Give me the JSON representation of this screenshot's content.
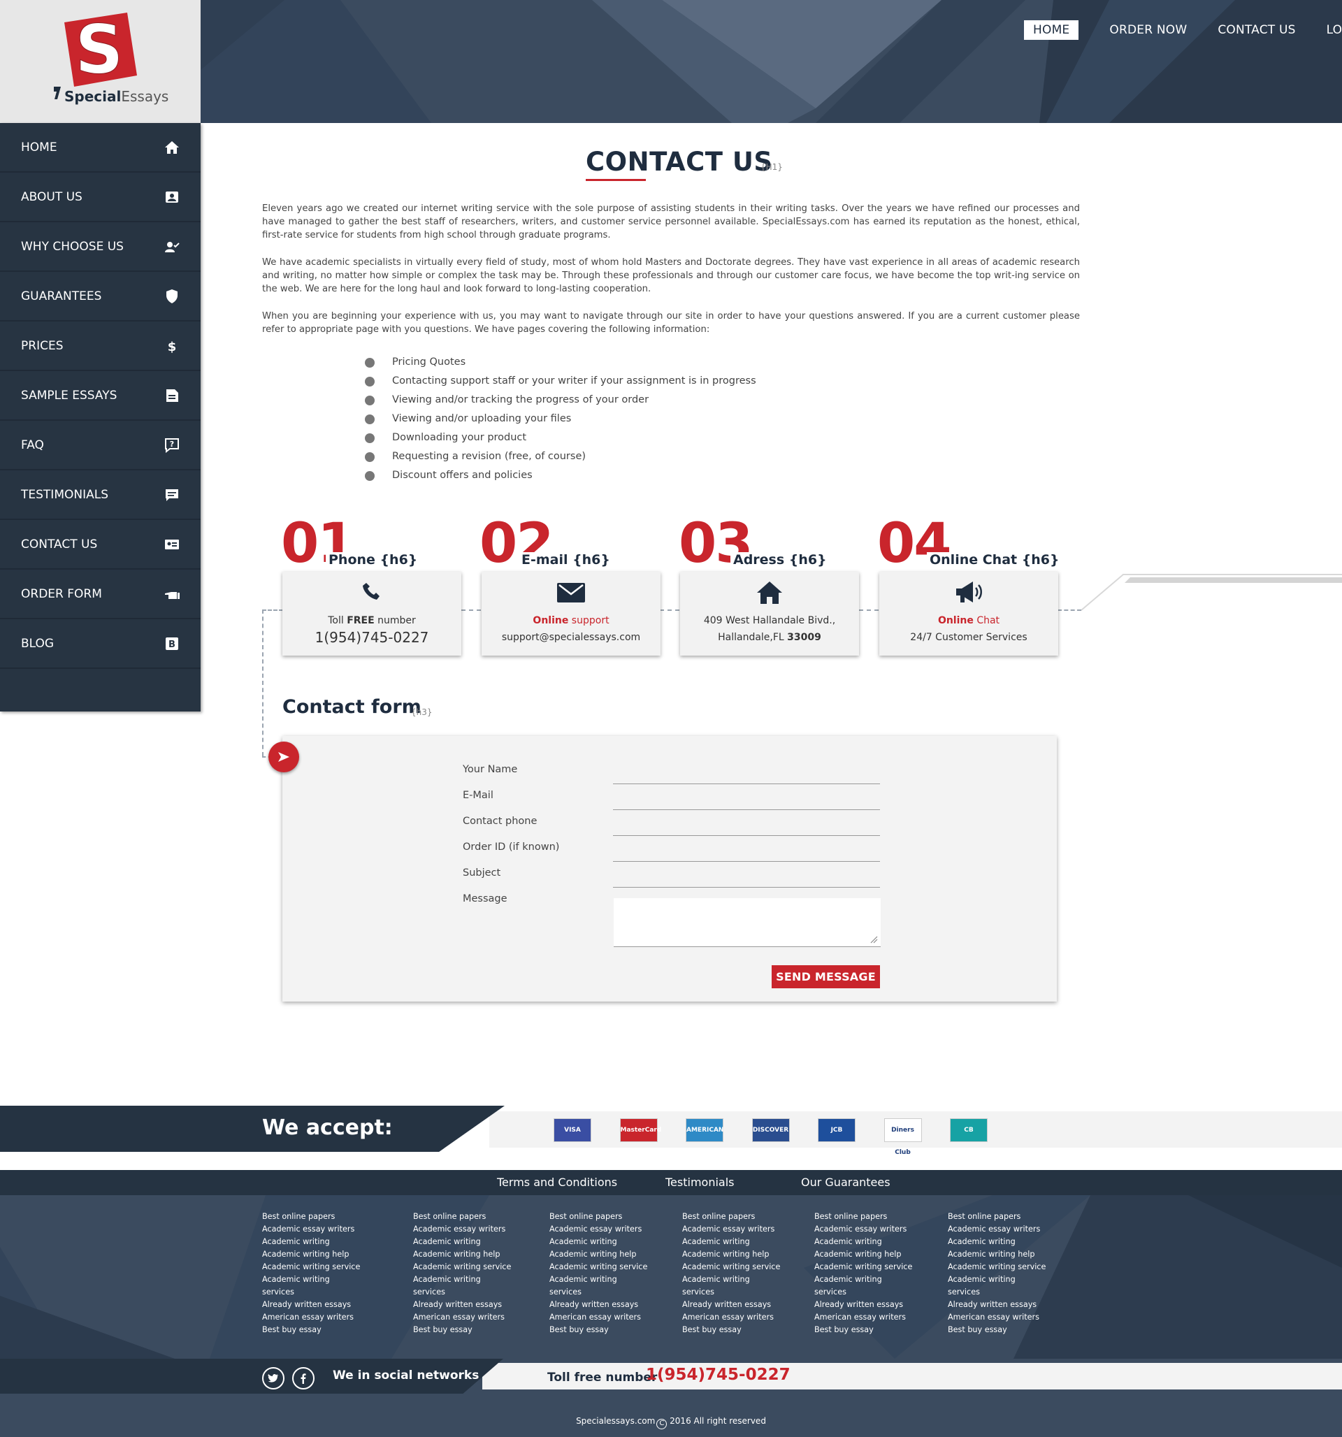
{
  "brand": {
    "special": "Special",
    "essays": "Essays"
  },
  "topnav": [
    {
      "label": "HOME",
      "active": true
    },
    {
      "label": "ORDER NOW"
    },
    {
      "label": "CONTACT US"
    },
    {
      "label": "LOGIN"
    }
  ],
  "sidebar": [
    {
      "label": "HOME",
      "icon": "home-icon"
    },
    {
      "label": "ABOUT US",
      "icon": "id-card-icon"
    },
    {
      "label": "WHY CHOOSE US",
      "icon": "user-check-icon"
    },
    {
      "label": "GUARANTEES",
      "icon": "shield-icon"
    },
    {
      "label": "PRICES",
      "icon": "dollar-icon"
    },
    {
      "label": "SAMPLE ESSAYS",
      "icon": "document-icon"
    },
    {
      "label": "FAQ",
      "icon": "question-bubble-icon"
    },
    {
      "label": "TESTIMONIALS",
      "icon": "comment-icon"
    },
    {
      "label": "CONTACT US",
      "icon": "contact-card-icon"
    },
    {
      "label": "ORDER FORM",
      "icon": "hand-point-icon"
    },
    {
      "label": "BLOG",
      "icon": "blog-icon"
    }
  ],
  "main": {
    "title": "CONTACT US",
    "title_tag": "{H1}",
    "paragraphs": [
      "Eleven years ago we created our internet writing service with the sole purpose of assisting students in their writing tasks. Over the years we have refined our processes and have managed to gather the best staff of researchers, writers, and customer service personnel available.  SpecialEssays.com has earned its reputation as the honest, ethical, first-rate service for students from high school through graduate programs.",
      "We have academic specialists in virtually every field of study, most of whom hold Masters and Doctorate degrees.  They have vast experience in all areas of academic research and writing, no matter how simple or complex the task may be. Through these professionals and through our customer care focus, we have become the top writ-ing service on the web.  We are here for the long haul and look forward to long-lasting cooperation.",
      "When you are beginning your experience with us, you may want to navigate through our site in order to have your questions answered.  If you are a current customer please refer to appropriate page with you questions.  We have pages covering the following information:"
    ],
    "bullets": [
      "Pricing Quotes",
      "Contacting support staff or your writer if your assignment is in progress",
      "Viewing and/or tracking the progress of your order",
      "Viewing and/or uploading your files",
      "Downloading your product",
      "Requesting a revision (free, of course)",
      "Discount offers and policies"
    ]
  },
  "steps": [
    {
      "num": "01",
      "title": "Phone {h6}",
      "icon": "phone-icon",
      "l1a": "Toll ",
      "l1b": "FREE",
      "l1c": " number",
      "l2": "1(954)745-0227"
    },
    {
      "num": "02",
      "title": "E-mail {h6}",
      "icon": "envelope-icon",
      "l1a": "",
      "l1b": "Online",
      "l1c": " support",
      "l2": "support@specialessays.com"
    },
    {
      "num": "03",
      "title": "Adress {h6}",
      "icon": "house-icon",
      "l1a": "409 West Hallandale Bivd.,",
      "l1b": "",
      "l1c": "",
      "l2a": "Hallandale,FL ",
      "l2b": "33009"
    },
    {
      "num": "04",
      "title": "Online Chat {h6}",
      "icon": "megaphone-icon",
      "l1a": "",
      "l1b": "Online",
      "l1c": " Chat",
      "l2": "24/7 Customer Services"
    }
  ],
  "form": {
    "title": "Contact form",
    "title_tag": "{h3}",
    "fields": [
      "Your Name",
      "E-Mail",
      "Contact phone",
      "Order ID (if known)",
      "Subject",
      "Message"
    ],
    "submit": "SEND MESSAGE"
  },
  "accept": {
    "title": "We accept:",
    "cards": [
      {
        "name": "VISA",
        "color": "#3a4ea3"
      },
      {
        "name": "MasterCard",
        "color": "#c9252c"
      },
      {
        "name": "AMERICAN EXPRESS",
        "color": "#2e8ac6"
      },
      {
        "name": "DISCOVER",
        "color": "#2a4d8f"
      },
      {
        "name": "JCB",
        "color": "#1e4f9c"
      },
      {
        "name": "Diners Club",
        "color": "#ffffff"
      },
      {
        "name": "CB",
        "color": "#17a2a4"
      }
    ]
  },
  "footer": {
    "nav": [
      "Terms and Conditions",
      "Testimonials",
      "Our Guarantees"
    ],
    "columns": [
      [
        "Best online papers",
        "Academic essay writers",
        "Academic writing",
        "Academic writing help",
        "Academic writing service",
        "Academic writing",
        "services",
        "Already written essays",
        "American essay writers",
        "Best buy essay"
      ],
      [
        "Best online papers",
        "Academic essay writers",
        "Academic writing",
        "Academic writing help",
        "Academic writing service",
        "Academic writing",
        "services",
        "Already written essays",
        "American essay writers",
        "Best buy essay"
      ],
      [
        "Best online papers",
        "Academic essay writers",
        "Academic writing",
        "Academic writing help",
        "Academic writing service",
        "Academic writing",
        "services",
        "Already written essays",
        "American essay writers",
        "Best buy essay"
      ],
      [
        "Best online papers",
        "Academic essay writers",
        "Academic writing",
        "Academic writing help",
        "Academic writing service",
        "Academic writing",
        "services",
        "Already written essays",
        "American essay writers",
        "Best buy essay"
      ],
      [
        "Best online papers",
        "Academic essay writers",
        "Academic writing",
        "Academic writing help",
        "Academic writing service",
        "Academic writing",
        "services",
        "Already written essays",
        "American essay writers",
        "Best buy essay"
      ],
      [
        "Best online papers",
        "Academic essay writers",
        "Academic writing",
        "Academic writing help",
        "Academic writing service",
        "Academic writing",
        "services",
        "Already written essays",
        "American essay writers",
        "Best buy essay"
      ]
    ],
    "social_label": "We in social networks",
    "toll_label": "Toll free number",
    "toll_number": "1(954)745-0227",
    "copyright_a": "Specialessays.com",
    "copyright_b": " 2016 All right reserved"
  },
  "colors": {
    "accent": "#c9252c",
    "navy": "#1f2d3f",
    "sidebar": "#273442",
    "banner": "#3b4b5f"
  }
}
